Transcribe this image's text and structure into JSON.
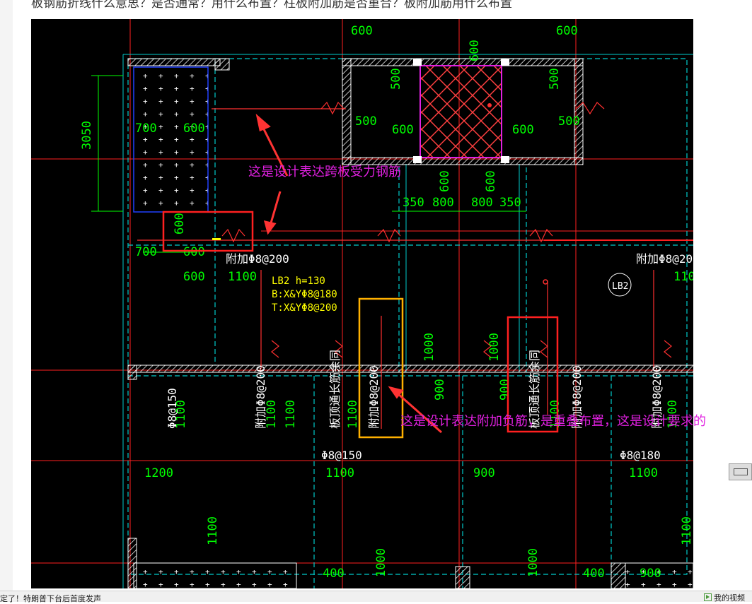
{
  "question": "板钢筋折线什么意思？是否通常？用什么布置？柱板附加筋是否重合？板附加筋用什么布置",
  "drawing": {
    "dims": [
      "3050",
      "600",
      "600",
      "600",
      "600",
      "500",
      "500",
      "500",
      "500",
      "600",
      "600",
      "600",
      "600",
      "700",
      "600",
      "600",
      "350",
      "800",
      "800",
      "350",
      "700",
      "600",
      "1100",
      "1100",
      "1100",
      "1100",
      "1100",
      "1100",
      "1100",
      "1100",
      "1100",
      "1100",
      "1200",
      "1100",
      "1100",
      "900",
      "900",
      "900",
      "1000",
      "1000",
      "1000",
      "1000",
      "400",
      "400",
      "900"
    ],
    "lb2": {
      "label": "LB2 h=130",
      "bottom": "B:X&YΦ8@180",
      "top": "T:X&YΦ8@200",
      "tag": "LB2"
    },
    "rebar_labels": {
      "fujia_h_left": "附加Φ8@200",
      "fujia_h_right": "附加Φ8@20",
      "phi150_v": "Φ8@150",
      "fujia_v_1": "附加Φ8@200",
      "tongchang_1": "板顶通长筋余同",
      "fujia_v_2": "附加Φ8@200",
      "tongchang_2": "板顶通长筋余同",
      "fujia_v_3": "附加Φ8@200",
      "fujia_v_4": "附加Φ8@200",
      "phi150_h": "Φ8@150",
      "phi180_h": "Φ8@180"
    }
  },
  "annotations": {
    "a1": "这是设计表达跨板受力钢筋",
    "a2": "这是设计表达附加负筋，是重叠布置，这是设计要求的"
  },
  "status_bar": {
    "news": "定了！特朗普下台后首度发声",
    "video": "我的视频"
  },
  "colors": {
    "background": "#000000",
    "dim": "#00ff00",
    "wall": "#ffffff",
    "axis": "#ff2020",
    "rebar": "#ff3030",
    "cyan": "#00cccc",
    "text_yellow": "#ffff00",
    "annotation": "#e020e0",
    "arrow": "#ff3333",
    "box_red": "#ff2020",
    "box_orange": "#ffb000"
  }
}
